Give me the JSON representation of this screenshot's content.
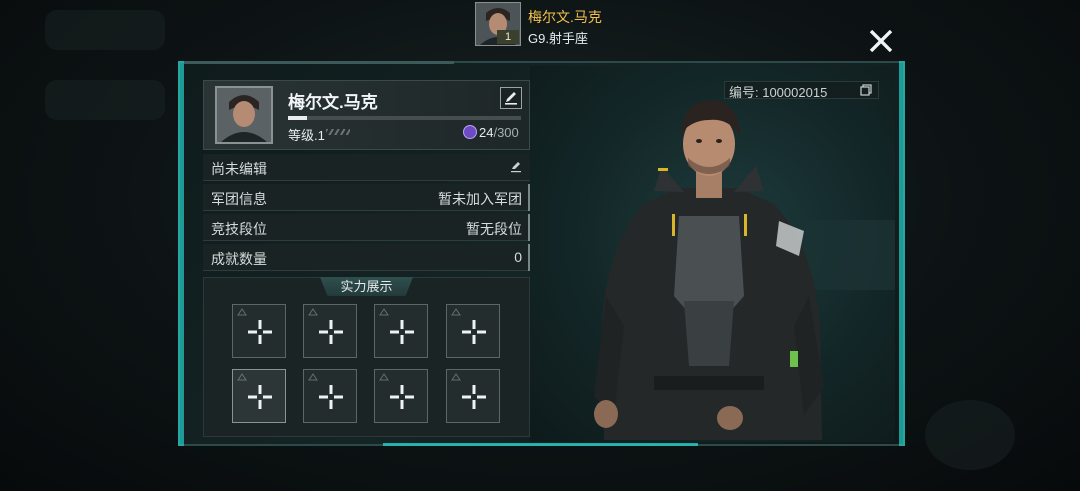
{
  "header": {
    "player_name": "梅尔文.马克",
    "player_level_badge": "1",
    "subtitle": "G9.射手座",
    "close_label": "✕"
  },
  "profile": {
    "name": "梅尔文.马克",
    "id_label": "编号: 100002015",
    "level_label": "等级.1",
    "exp_current": "24",
    "exp_max": "/300",
    "exp_fraction": 0.08
  },
  "info_rows": [
    {
      "key": "尚未编辑",
      "value": ""
    },
    {
      "key": "军团信息",
      "value": "暂未加入军团"
    },
    {
      "key": "竞技段位",
      "value": "暂无段位"
    },
    {
      "key": "成就数量",
      "value": "0"
    }
  ],
  "showcase": {
    "title": "实力展示",
    "slot_count": 8
  },
  "colors": {
    "accent": "#25cfc8",
    "name_gold": "#f2c24a"
  }
}
